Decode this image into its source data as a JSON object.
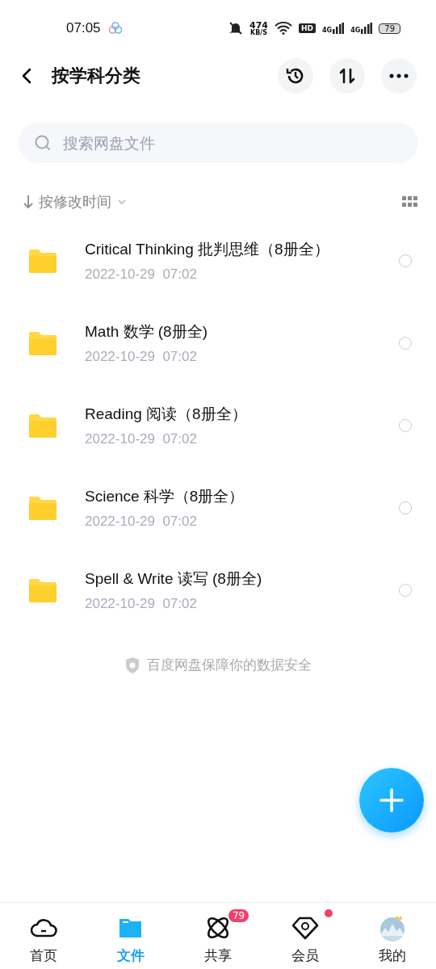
{
  "status_bar": {
    "time": "07:05",
    "speed_value": "474",
    "speed_unit": "KB/S",
    "hd": "HD",
    "network_1": "4G",
    "network_2": "4G",
    "battery": "79"
  },
  "header": {
    "title": "按学科分类"
  },
  "search": {
    "placeholder": "搜索网盘文件"
  },
  "sort": {
    "label": "按修改时间"
  },
  "files": [
    {
      "name": "Critical Thinking 批判思维（8册全）",
      "date": "2022-10-29  07:02",
      "selected": false
    },
    {
      "name": "Math 数学 (8册全)",
      "date": "2022-10-29  07:02",
      "selected": false
    },
    {
      "name": "Reading 阅读（8册全）",
      "date": "2022-10-29  07:02",
      "selected": false
    },
    {
      "name": "Science 科学（8册全）",
      "date": "2022-10-29  07:02",
      "selected": false
    },
    {
      "name": "Spell & Write 读写 (8册全)",
      "date": "2022-10-29  07:02",
      "selected": false
    }
  ],
  "footer_note": "百度网盘保障你的数据安全",
  "tabs": [
    {
      "kind": "home",
      "label": "首页",
      "selected": false
    },
    {
      "kind": "files",
      "label": "文件",
      "selected": true
    },
    {
      "kind": "share",
      "label": "共享",
      "selected": false,
      "badge": "79"
    },
    {
      "kind": "vip",
      "label": "会员",
      "selected": false,
      "dot": true
    },
    {
      "kind": "me",
      "label": "我的",
      "selected": false
    }
  ]
}
